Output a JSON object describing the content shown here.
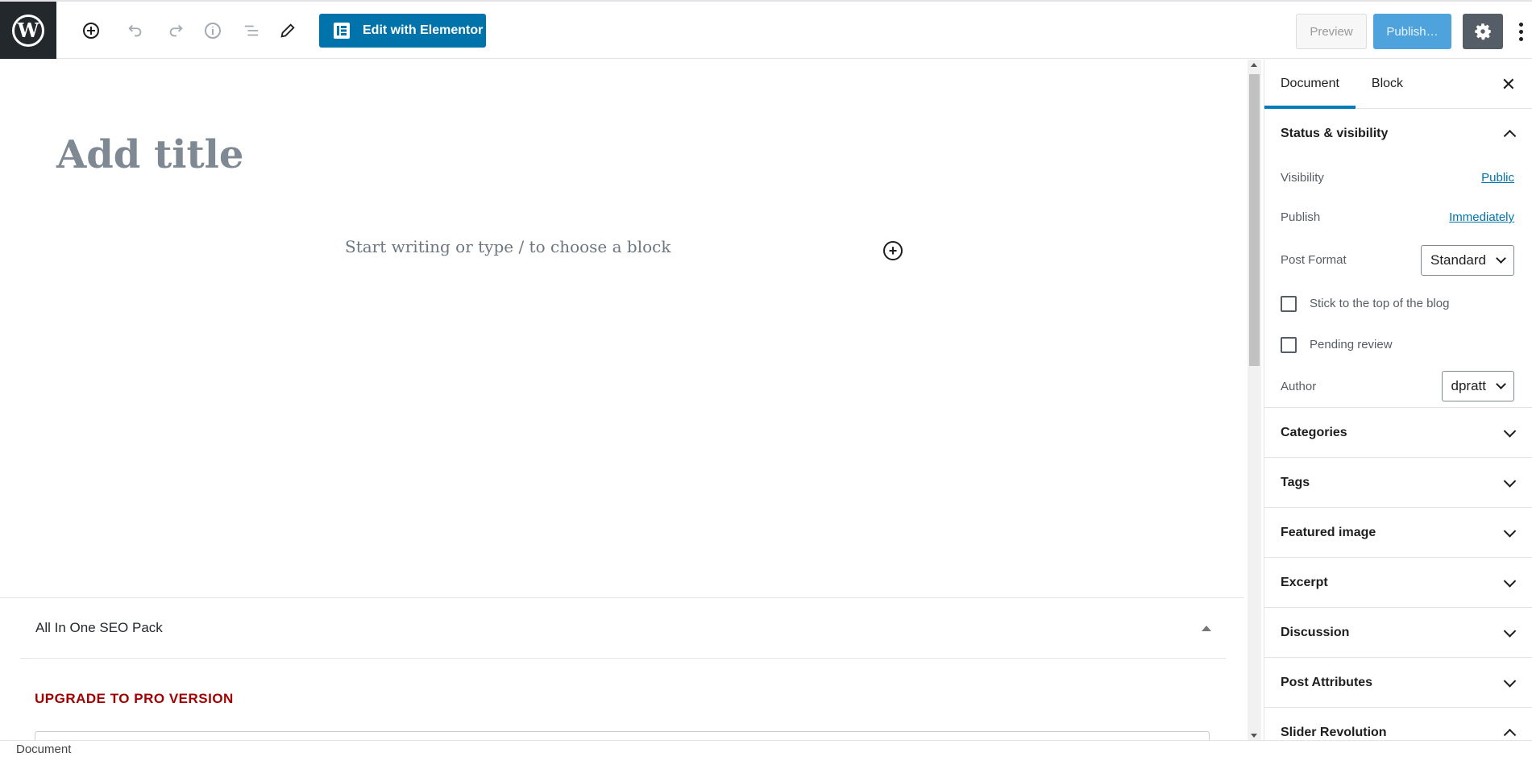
{
  "toolbar": {
    "edit_with_elementor": "Edit with Elementor",
    "preview": "Preview",
    "publish": "Publish…"
  },
  "editor": {
    "title_placeholder": "Add title",
    "block_placeholder": "Start writing or type / to choose a block"
  },
  "seo": {
    "panel_title": "All In One SEO Pack",
    "upgrade_text": "UPGRADE TO PRO VERSION"
  },
  "sidebar": {
    "tabs": [
      "Document",
      "Block"
    ],
    "status": {
      "title": "Status & visibility",
      "visibility_label": "Visibility",
      "visibility_value": "Public",
      "publish_label": "Publish",
      "publish_value": "Immediately",
      "post_format_label": "Post Format",
      "post_format_value": "Standard",
      "stick_label": "Stick to the top of the blog",
      "pending_label": "Pending review",
      "author_label": "Author",
      "author_value": "dpratt"
    },
    "panels": [
      "Categories",
      "Tags",
      "Featured image",
      "Excerpt",
      "Discussion",
      "Post Attributes",
      "Slider Revolution"
    ]
  },
  "footer": {
    "breadcrumb": "Document"
  },
  "icons": [
    "wordpress-logo-icon",
    "add-block-icon",
    "undo-icon",
    "redo-icon",
    "info-icon",
    "outline-icon",
    "edit-icon",
    "gear-icon",
    "more-options-icon",
    "close-icon"
  ],
  "colors": {
    "primary": "#0073aa",
    "publish_disabled": "#4fa3dd",
    "dark_header": "#23282d",
    "upgrade_red": "#a00000"
  }
}
